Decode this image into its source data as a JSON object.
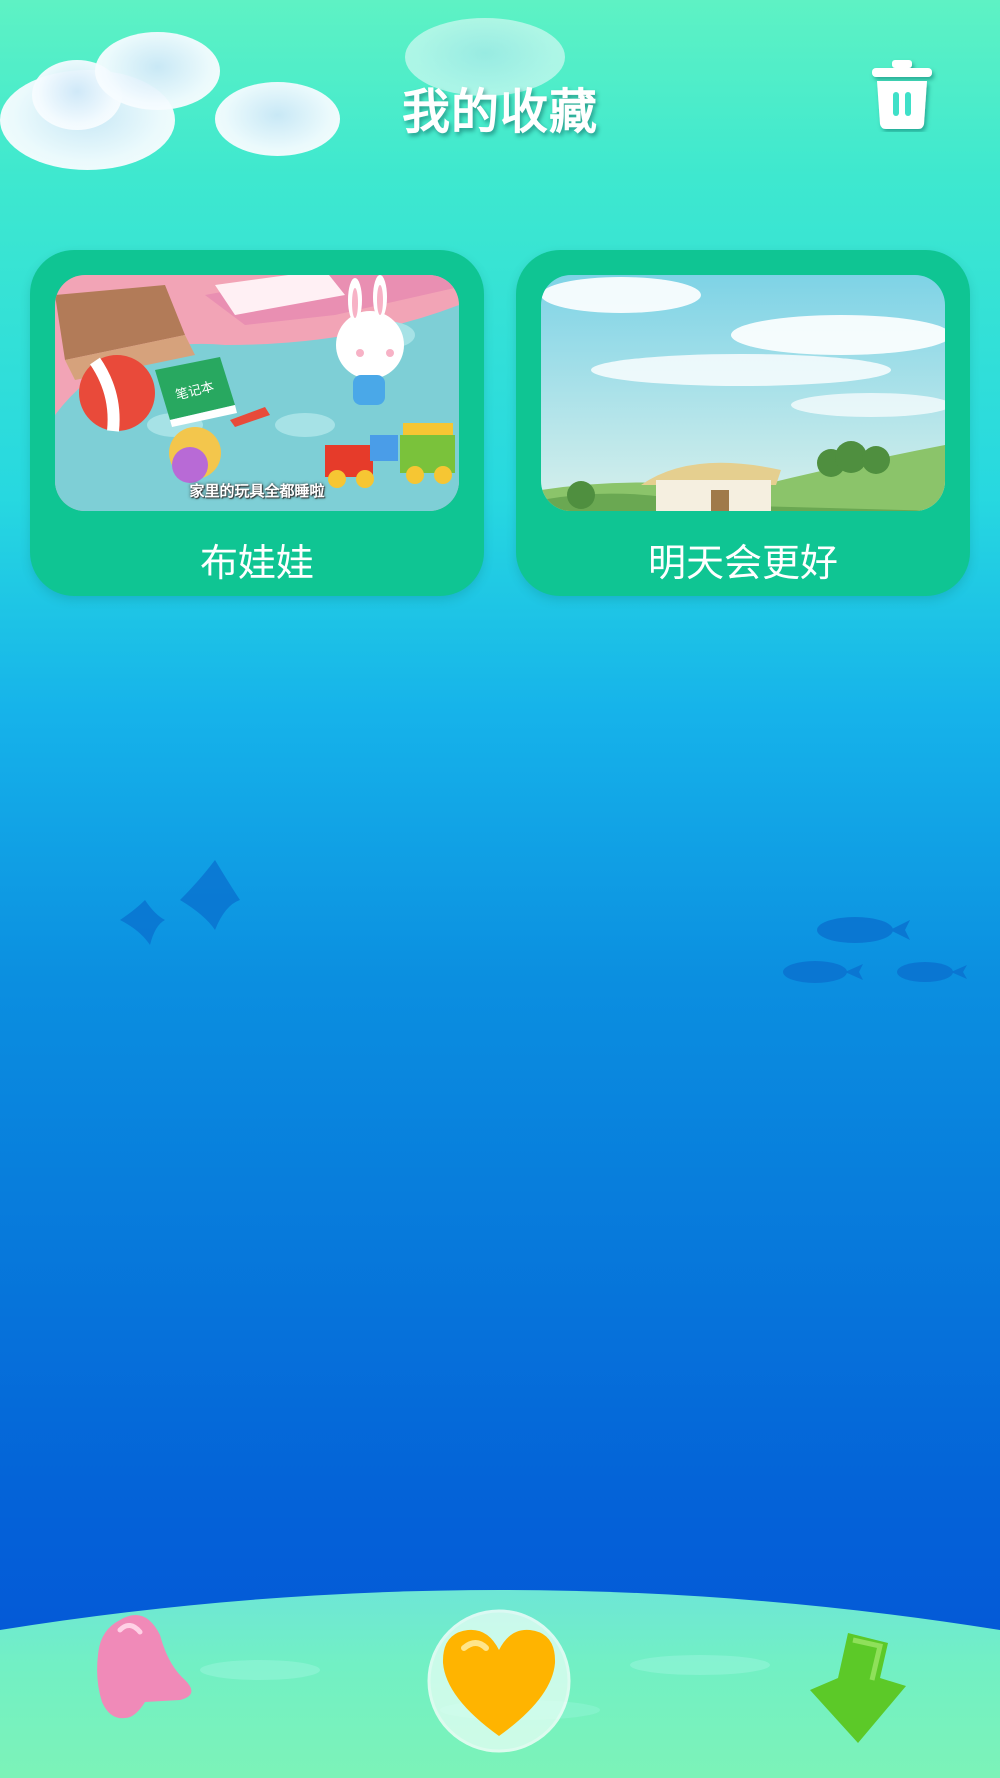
{
  "header": {
    "title": "我的收藏",
    "delete_icon": "trash-icon"
  },
  "favorites": [
    {
      "label": "布娃娃",
      "subtitle": "家里的玩具全都睡啦",
      "book_text": "笔记本"
    },
    {
      "label": "明天会更好"
    }
  ],
  "bottom_nav": {
    "left_icon": "pink-bell-icon",
    "center_icon": "heart-icon",
    "right_icon": "down-arrow-icon"
  },
  "colors": {
    "card_bg": "#0fc593",
    "heart": "#ffb400",
    "bell": "#f08ab8",
    "arrow": "#5cc928"
  }
}
